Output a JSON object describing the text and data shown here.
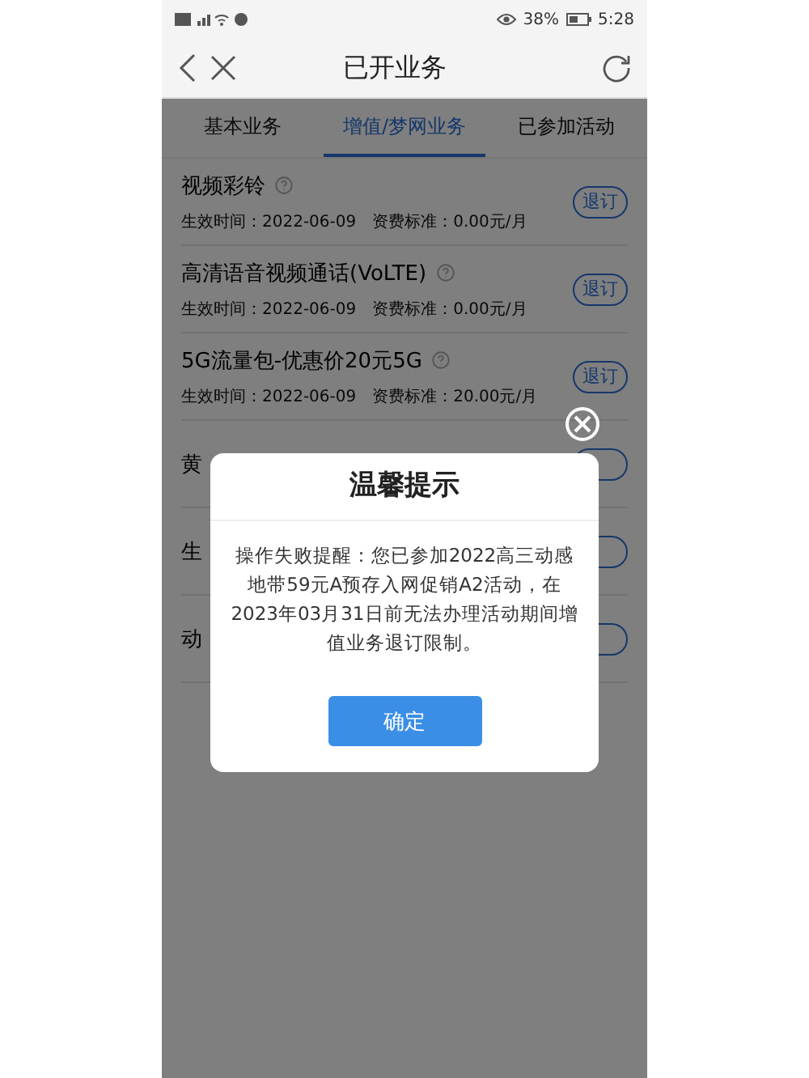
{
  "status_bar": {
    "battery": "38%",
    "time": "5:28"
  },
  "nav": {
    "title": "已开业务"
  },
  "tabs": [
    {
      "label": "基本业务",
      "selected": false
    },
    {
      "label": "增值/梦网业务",
      "selected": true
    },
    {
      "label": "已参加活动",
      "selected": false
    }
  ],
  "services": [
    {
      "name": "视频彩铃",
      "kind": "full",
      "meta": "生效时间：2022-06-09　资费标准：0.00元/月",
      "button": "退订"
    },
    {
      "name": "高清语音视频通话(VoLTE)",
      "kind": "full",
      "meta": "生效时间：2022-06-09　资费标准：0.00元/月",
      "button": "退订"
    },
    {
      "name": "5G流量包-优惠价20元5G",
      "kind": "full",
      "meta": "生效时间：2022-06-09　资费标准：20.00元/月",
      "button": "退订"
    },
    {
      "name": "黄",
      "kind": "covered"
    },
    {
      "name": "生",
      "kind": "covered"
    },
    {
      "name": "动",
      "kind": "covered"
    }
  ],
  "dialog": {
    "title": "温馨提示",
    "message": "操作失败提醒：您已参加2022高三动感地带59元A预存入网促销A2活动，在2023年03月31日前无法办理活动期间增值业务退订限制。",
    "button": "确定"
  }
}
